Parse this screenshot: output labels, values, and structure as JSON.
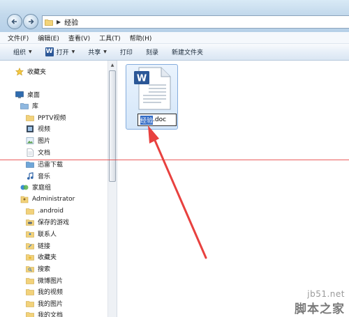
{
  "address": {
    "path": "经验"
  },
  "menu": [
    "文件(F)",
    "编辑(E)",
    "查看(V)",
    "工具(T)",
    "帮助(H)"
  ],
  "toolbar": {
    "organize": "组织",
    "open": "打开",
    "share": "共享",
    "print": "打印",
    "burn": "刻录",
    "new_folder": "新建文件夹"
  },
  "sidebar": {
    "favorites": "收藏夹",
    "desktop": "桌面",
    "libraries": "库",
    "pptv": "PPTV视频",
    "videos": "视频",
    "pictures": "图片",
    "documents": "文档",
    "thunder": "迅雷下载",
    "music": "音乐",
    "homegroup": "家庭组",
    "administrator": "Administrator",
    "android": ".android",
    "saved_games": "保存的游戏",
    "contacts": "联系人",
    "links": "链接",
    "favorites2": "收藏夹",
    "searches": "搜索",
    "weibo_pics": "微博图片",
    "my_videos": "我的视频",
    "my_pictures": "我的图片",
    "my_documents": "我的文档"
  },
  "file": {
    "rename_selected": "经验",
    "rename_suffix": ".doc",
    "icon_letter": "W"
  },
  "watermark": {
    "site": "jb51.net",
    "name": "脚本之家"
  },
  "colors": {
    "annotation": "#e8413f",
    "word_blue": "#2b5797",
    "selection": "#316ac5"
  }
}
